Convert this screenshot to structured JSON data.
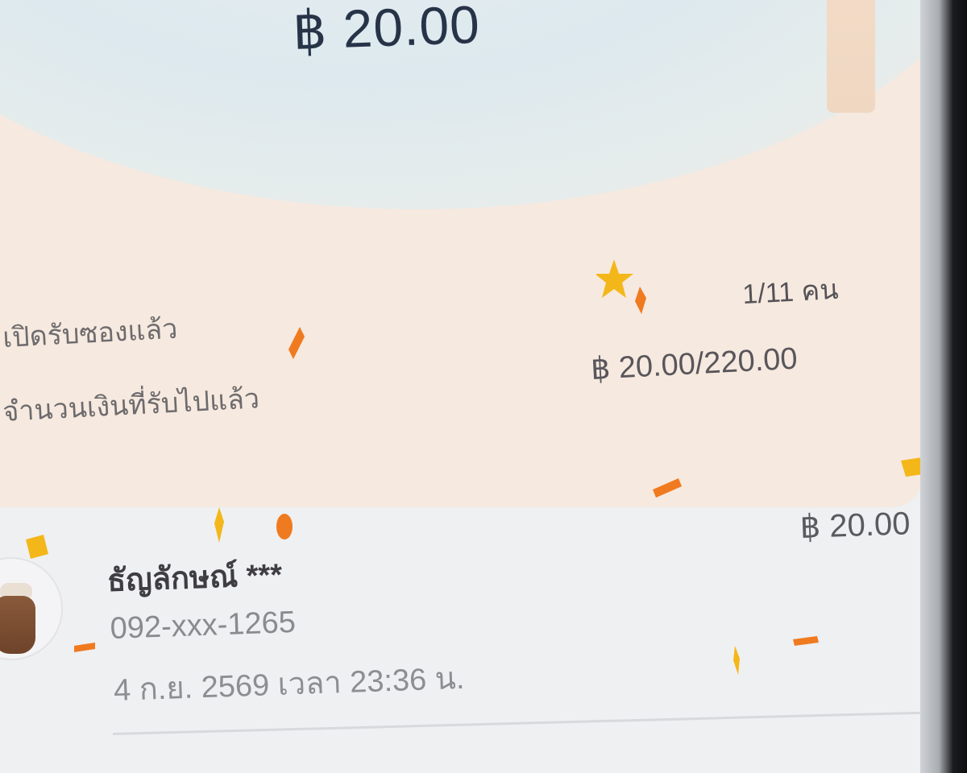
{
  "header": {
    "amount": "฿ 20.00"
  },
  "summary": {
    "status_label": "เปิดรับซองแล้ว",
    "received_label": "จำนวนเงินที่รับไปแล้ว",
    "participants": "1/11 คน",
    "received_amount": "฿ 20.00/220.00"
  },
  "recipients": [
    {
      "name": "ธัญลักษณ์ ***",
      "phone": "092-xxx-1265",
      "datetime": "4 ก.ย. 2569 เวลา 23:36 น.",
      "amount": "฿ 20.00"
    }
  ],
  "theme": {
    "text_dark": "#273448",
    "text_muted": "#8b8a8f",
    "card_peach": "#f6e9df",
    "confetti_orange": "#f07a1f",
    "confetti_yellow": "#f4b71a"
  },
  "icons": {
    "avatar": "money-bag-icon",
    "decor": "confetti-icon"
  }
}
